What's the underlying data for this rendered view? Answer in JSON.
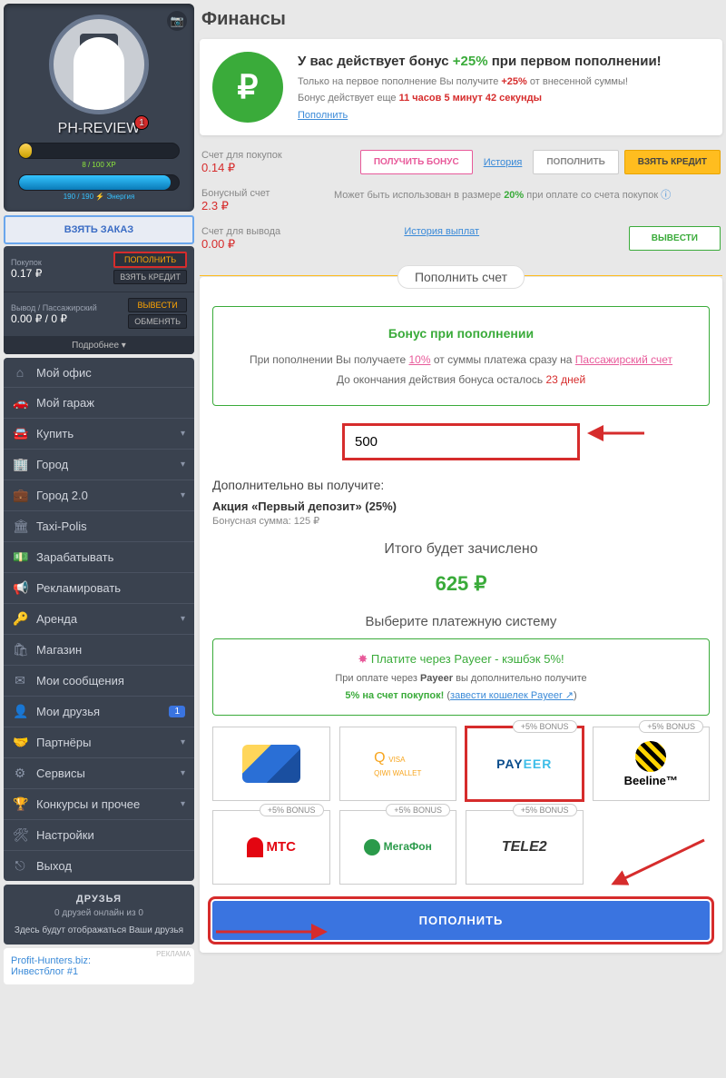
{
  "page_title": "Финансы",
  "profile": {
    "username": "PH-REVIEW",
    "notif": "1",
    "xp_text": "8 / 100 XP",
    "energy_text": "190 / 190 ⚡ Энергия",
    "take_order": "ВЗЯТЬ ЗАКАЗ"
  },
  "mini": {
    "buy_label": "Покупок",
    "buy_val": "0.17 ₽",
    "btn_topup": "ПОПОЛНИТЬ",
    "btn_credit": "ВЗЯТЬ КРЕДИТ",
    "out_label": "Вывод / Пассажирский",
    "out_val": "0.00 ₽ / 0 ₽",
    "btn_withdraw": "ВЫВЕСТИ",
    "btn_exchange": "ОБМЕНЯТЬ",
    "more": "Подробнее ▾"
  },
  "nav": [
    {
      "ico": "⌂",
      "t": "Мой офис"
    },
    {
      "ico": "🚗",
      "t": "Мой гараж"
    },
    {
      "ico": "🚘",
      "t": "Купить",
      "c": true
    },
    {
      "ico": "🏢",
      "t": "Город",
      "c": true
    },
    {
      "ico": "💼",
      "t": "Город 2.0",
      "c": true
    },
    {
      "ico": "🏛",
      "t": "Taxi-Polis"
    },
    {
      "ico": "💵",
      "t": "Зарабатывать"
    },
    {
      "ico": "📢",
      "t": "Рекламировать"
    },
    {
      "ico": "🔑",
      "t": "Аренда",
      "c": true
    },
    {
      "ico": "🛍",
      "t": "Магазин"
    },
    {
      "ico": "✉",
      "t": "Мои сообщения"
    },
    {
      "ico": "👤",
      "t": "Мои друзья",
      "b": "1"
    },
    {
      "ico": "🤝",
      "t": "Партнёры",
      "c": true
    },
    {
      "ico": "⚙",
      "t": "Сервисы",
      "c": true
    },
    {
      "ico": "🏆",
      "t": "Конкурсы и прочее",
      "c": true
    },
    {
      "ico": "🛠",
      "t": "Настройки"
    },
    {
      "ico": "⎋",
      "t": "Выход"
    }
  ],
  "friends": {
    "title": "ДРУЗЬЯ",
    "sub": "0 друзей онлайн из 0",
    "empty": "Здесь будут отображаться Ваши друзья"
  },
  "ad": {
    "tag": "РЕКЛАМА",
    "l1": "Profit-Hunters.biz:",
    "l2": "Инвестблог #1"
  },
  "bonus_top": {
    "title_a": "У вас действует бонус ",
    "title_b": "+25%",
    "title_c": " при первом пополнении!",
    "line1_a": "Только на первое пополнение Вы получите ",
    "line1_b": "+25%",
    "line1_c": " от внесенной суммы!",
    "line2_a": "Бонус действует еще ",
    "line2_b": "11 часов 5 минут 42 секунды",
    "link": "Пополнить"
  },
  "acct_buy": {
    "label": "Счет для покупок",
    "value": "0.14 ₽",
    "btn_bonus": "ПОЛУЧИТЬ БОНУС",
    "history": "История",
    "btn_topup": "ПОПОЛНИТЬ",
    "btn_credit": "ВЗЯТЬ КРЕДИТ"
  },
  "acct_bonus": {
    "label": "Бонусный счет",
    "value": "2.3 ₽",
    "note_a": "Может быть использован в размере ",
    "note_b": "20%",
    "note_c": " при оплате со счета покупок "
  },
  "acct_out": {
    "label": "Счет для вывода",
    "value": "0.00 ₽",
    "history": "История выплат",
    "btn": "ВЫВЕСТИ"
  },
  "ribbon": "Пополнить счет",
  "binfo": {
    "h": "Бонус при пополнении",
    "l1_a": "При пополнении Вы получаете ",
    "l1_b": "10%",
    "l1_c": " от суммы платежа сразу на ",
    "l1_d": "Пассажирский счет",
    "l2_a": "До окончания действия бонуса осталось ",
    "l2_b": "23 дней"
  },
  "amount": "500",
  "extra": {
    "h": "Дополнительно вы получите:",
    "promo": "Акция «Первый депозит» (25%)",
    "bsum": "Бонусная сумма: 125 ₽",
    "total_l": "Итого будет зачислено",
    "total_v": "625 ₽"
  },
  "choose": "Выберите платежную систему",
  "pbox": {
    "t": "Платите через Payeer - кэшбэк 5%!",
    "l1_a": "При оплате через ",
    "l1_b": "Payeer",
    "l1_c": " вы дополнительно получите",
    "l2_a": "5% на счет покупок!",
    "l2_b": " (",
    "l2_c": "завести кошелек Payeer ↗",
    "l2_d": ")"
  },
  "pay": {
    "bonus_tag": "+5% BONUS",
    "visa_a": "VISA",
    "visa_b": "QIWI WALLET",
    "payeer": "PAYEER",
    "beeline": "Beeline™",
    "mts": "МТС",
    "mega": "МегаФон",
    "tele2": "TELE2"
  },
  "big_btn": "ПОПОЛНИТЬ"
}
